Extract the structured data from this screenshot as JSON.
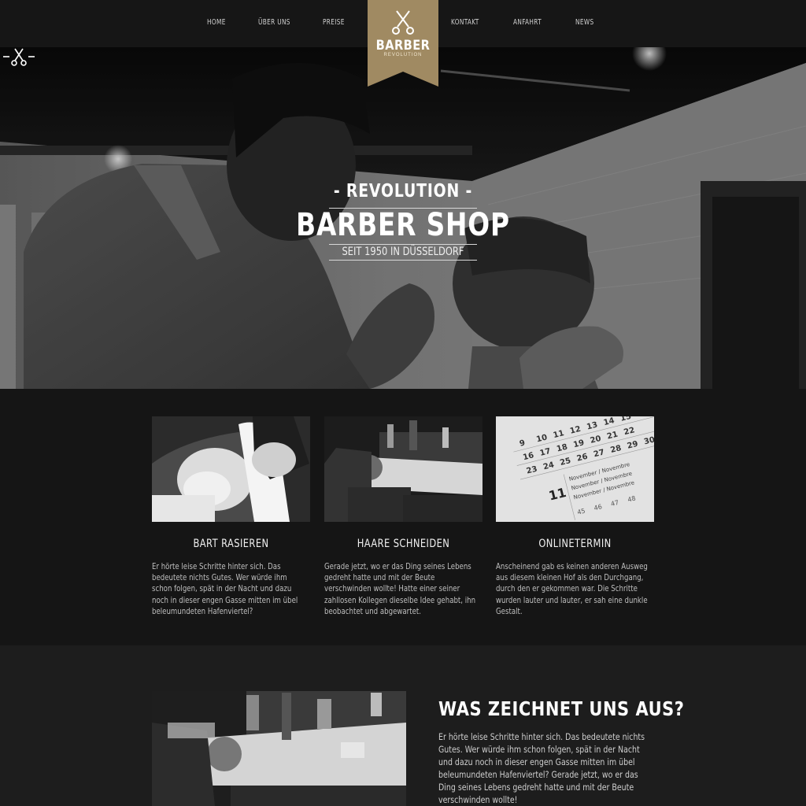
{
  "nav": {
    "items": [
      "HOME",
      "ÜBER UNS",
      "PREISE",
      "KONTAKT",
      "ANFAHRT",
      "NEWS"
    ],
    "logo_title": "BARBER",
    "logo_subtitle": "REVOLUTION"
  },
  "hero": {
    "pretitle": "- REVOLUTION -",
    "title": "BARBER SHOP",
    "subtitle": "SEIT 1950 IN DÜSSELDORF"
  },
  "services": [
    {
      "title": "BART RASIEREN",
      "text": "Er hörte leise Schritte hinter sich. Das bedeutete nichts Gutes. Wer würde ihm schon folgen, spät in der Nacht und dazu noch in dieser engen Gasse mitten im übel beleumundeten Hafenviertel?"
    },
    {
      "title": "HAARE SCHNEIDEN",
      "text": "Gerade jetzt, wo er das Ding seines Lebens gedreht hatte und mit der Beute verschwinden wollte! Hatte einer seiner zahllosen Kollegen dieselbe Idee gehabt, ihn beobachtet und abgewartet."
    },
    {
      "title": "ONLINETERMIN",
      "text": "Anscheinend gab es keinen anderen Ausweg aus diesem kleinen Hof als den Durchgang, durch den er gekommen war. Die Schritte wurden lauter und lauter, er sah eine dunkle Gestalt."
    }
  ],
  "about": {
    "title": "WAS ZEICHNET UNS AUS?",
    "text": "Er hörte leise Schritte hinter sich. Das bedeutete nichts Gutes. Wer würde ihm schon folgen, spät in der Nacht und dazu noch in dieser engen Gasse mitten im übel beleumundeten Hafenviertel? Gerade jetzt, wo er das Ding seines Lebens gedreht hatte und mit der Beute verschwinden wollte!"
  },
  "calendar": {
    "numbers": [
      "9",
      "10",
      "11",
      "12",
      "13",
      "14",
      "15",
      "16",
      "17",
      "18",
      "19",
      "20",
      "21",
      "22",
      "23",
      "24",
      "25",
      "26",
      "27",
      "28",
      "29",
      "30"
    ],
    "month_labels": [
      "November / Novembre",
      "November / Novembre",
      "November / Novembre"
    ],
    "big_number": "11",
    "bottom_numbers": [
      "45",
      "46",
      "47",
      "48"
    ]
  },
  "colors": {
    "nav_bg": "#161616",
    "badge_gold": "#a08a62",
    "page_bg": "#151515",
    "about_bg": "#1d1d1d"
  },
  "icons": [
    "scissors-icon"
  ]
}
